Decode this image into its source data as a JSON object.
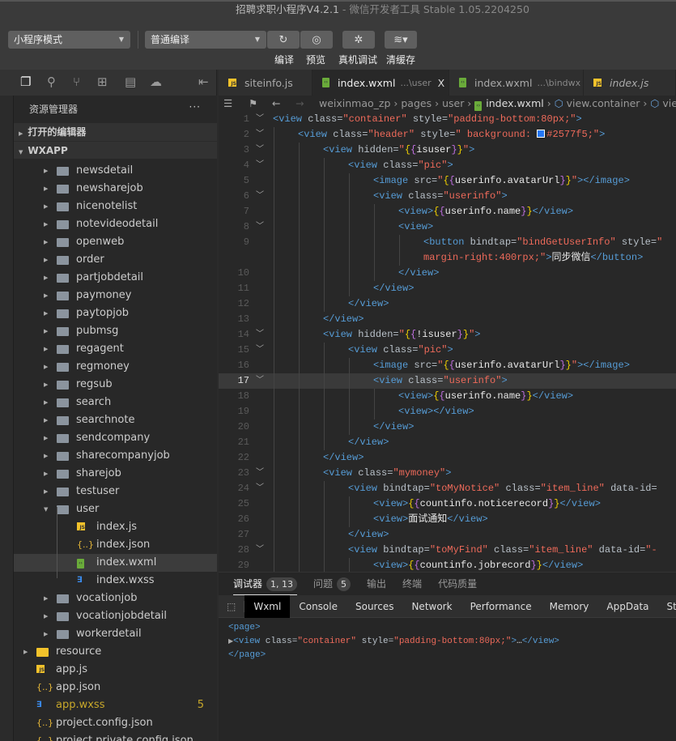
{
  "window": {
    "title": "招聘求职小程序V4.2.1",
    "subtitle": " - 微信开发者工具 Stable 1.05.2204250"
  },
  "toolbar": {
    "mode": "小程序模式",
    "compile_mode": "普通编译",
    "compile": "编译",
    "preview": "预览",
    "remote_debug": "真机调试",
    "clear_cache": "清缓存"
  },
  "sidebar": {
    "title": "资源管理器",
    "more": "···",
    "open_editors": "打开的编辑器",
    "root": "WXAPP",
    "items": [
      {
        "label": "newsdetail",
        "type": "folder",
        "depth": 2
      },
      {
        "label": "newsharejob",
        "type": "folder",
        "depth": 2
      },
      {
        "label": "nicenotelist",
        "type": "folder",
        "depth": 2
      },
      {
        "label": "notevideodetail",
        "type": "folder",
        "depth": 2
      },
      {
        "label": "openweb",
        "type": "folder",
        "depth": 2
      },
      {
        "label": "order",
        "type": "folder",
        "depth": 2
      },
      {
        "label": "partjobdetail",
        "type": "folder",
        "depth": 2
      },
      {
        "label": "paymoney",
        "type": "folder",
        "depth": 2
      },
      {
        "label": "paytopjob",
        "type": "folder",
        "depth": 2
      },
      {
        "label": "pubmsg",
        "type": "folder",
        "depth": 2
      },
      {
        "label": "regagent",
        "type": "folder",
        "depth": 2
      },
      {
        "label": "regmoney",
        "type": "folder",
        "depth": 2
      },
      {
        "label": "regsub",
        "type": "folder",
        "depth": 2
      },
      {
        "label": "search",
        "type": "folder",
        "depth": 2
      },
      {
        "label": "searchnote",
        "type": "folder",
        "depth": 2
      },
      {
        "label": "sendcompany",
        "type": "folder",
        "depth": 2
      },
      {
        "label": "sharecompanyjob",
        "type": "folder",
        "depth": 2
      },
      {
        "label": "sharejob",
        "type": "folder",
        "depth": 2
      },
      {
        "label": "testuser",
        "type": "folder",
        "depth": 2
      },
      {
        "label": "user",
        "type": "folder-open",
        "depth": 2
      },
      {
        "label": "index.js",
        "type": "js",
        "depth": 3
      },
      {
        "label": "index.json",
        "type": "json",
        "depth": 3
      },
      {
        "label": "index.wxml",
        "type": "wxml",
        "depth": 3,
        "selected": true
      },
      {
        "label": "index.wxss",
        "type": "wxss",
        "depth": 3
      },
      {
        "label": "vocationjob",
        "type": "folder",
        "depth": 2
      },
      {
        "label": "vocationjobdetail",
        "type": "folder",
        "depth": 2
      },
      {
        "label": "workerdetail",
        "type": "folder",
        "depth": 2
      },
      {
        "label": "resource",
        "type": "folder-res",
        "depth": 1
      },
      {
        "label": "app.js",
        "type": "js",
        "depth": 1
      },
      {
        "label": "app.json",
        "type": "json",
        "depth": 1
      },
      {
        "label": "app.wxss",
        "type": "wxss",
        "depth": 1,
        "badge": "5",
        "modified": true
      },
      {
        "label": "project.config.json",
        "type": "json",
        "depth": 1
      },
      {
        "label": "project.private.config.json",
        "type": "json",
        "depth": 1
      }
    ]
  },
  "tabs": [
    {
      "label": "siteinfo.js",
      "type": "js"
    },
    {
      "label": "index.wxml",
      "hint": "...\\user",
      "type": "wxml",
      "active": true,
      "close": "X"
    },
    {
      "label": "index.wxml",
      "hint": "...\\bindwx",
      "type": "wxml"
    },
    {
      "label": "index.js",
      "type": "js",
      "italic": true
    }
  ],
  "breadcrumb": [
    "weixinmao_zp",
    "pages",
    "user",
    "index.wxml",
    "view.container",
    "vie"
  ],
  "editor": {
    "current_line": 17,
    "color_swatch": "#2577f5",
    "lines": [
      {
        "n": "1",
        "i": 0,
        "f": true,
        "c": "<view class=\"container\" style=\"padding-bottom:80px;\">"
      },
      {
        "n": "2",
        "i": 1,
        "f": true,
        "c": "<view class=\"header\" style=\" background: ■#2577f5;\">"
      },
      {
        "n": "3",
        "i": 2,
        "f": true,
        "c": "<view hidden=\"{{isuser}}\">"
      },
      {
        "n": "4",
        "i": 3,
        "f": true,
        "c": "<view class=\"pic\">"
      },
      {
        "n": "5",
        "i": 4,
        "c": "<image src=\"{{userinfo.avatarUrl}}\"></image>"
      },
      {
        "n": "6",
        "i": 4,
        "f": true,
        "c": "<view class=\"userinfo\">"
      },
      {
        "n": "7",
        "i": 5,
        "c": "<view>{{userinfo.name}}</view>"
      },
      {
        "n": "8",
        "i": 5,
        "f": true,
        "c": "<view>"
      },
      {
        "n": "9",
        "i": 6,
        "c": "<button bindtap=\"bindGetUserInfo\" style=\""
      },
      {
        "n": "",
        "i": 6,
        "c": "\u0001margin-right:400rpx;\">同步微信</button>"
      },
      {
        "n": "10",
        "i": 5,
        "c": "</view>"
      },
      {
        "n": "11",
        "i": 4,
        "c": "</view>"
      },
      {
        "n": "12",
        "i": 3,
        "c": "</view>"
      },
      {
        "n": "13",
        "i": 2,
        "c": "</view>"
      },
      {
        "n": "14",
        "i": 2,
        "f": true,
        "c": "<view hidden=\"{{!isuser}}\">"
      },
      {
        "n": "15",
        "i": 3,
        "f": true,
        "c": "<view class=\"pic\">"
      },
      {
        "n": "16",
        "i": 4,
        "c": "<image src=\"{{userinfo.avatarUrl}}\"></image>"
      },
      {
        "n": "17",
        "i": 4,
        "f": true,
        "c": "<view class=\"userinfo\">"
      },
      {
        "n": "18",
        "i": 5,
        "c": "<view>{{userinfo.name}}</view>"
      },
      {
        "n": "19",
        "i": 5,
        "c": "<view></view>"
      },
      {
        "n": "20",
        "i": 4,
        "c": "</view>"
      },
      {
        "n": "21",
        "i": 3,
        "c": "</view>"
      },
      {
        "n": "22",
        "i": 2,
        "c": "</view>"
      },
      {
        "n": "23",
        "i": 2,
        "f": true,
        "c": "<view class=\"mymoney\">"
      },
      {
        "n": "24",
        "i": 3,
        "f": true,
        "c": "<view bindtap=\"toMyNotice\" class=\"item_line\" data-id="
      },
      {
        "n": "25",
        "i": 4,
        "c": "<view>{{countinfo.noticerecord}}</view>"
      },
      {
        "n": "26",
        "i": 4,
        "c": "<view>面试通知</view>"
      },
      {
        "n": "27",
        "i": 3,
        "c": "</view>"
      },
      {
        "n": "28",
        "i": 3,
        "f": true,
        "c": "<view bindtap=\"toMyFind\" class=\"item_line\" data-id=\"-"
      },
      {
        "n": "29",
        "i": 4,
        "c": "<view>{{countinfo.jobrecord}}</view>"
      }
    ]
  },
  "panel": {
    "tabs": [
      {
        "label": "调试器",
        "badge": "1, 13",
        "active": true
      },
      {
        "label": "问题",
        "badge": "5"
      },
      {
        "label": "输出"
      },
      {
        "label": "终端"
      },
      {
        "label": "代码质量"
      }
    ],
    "devtools_tabs": [
      "Wxml",
      "Console",
      "Sources",
      "Network",
      "Performance",
      "Memory",
      "AppData",
      "Storag"
    ],
    "dom": [
      "<page>",
      "<view class=\"container\" style=\"padding-bottom:80px;\">…</view>",
      "</page>"
    ]
  }
}
